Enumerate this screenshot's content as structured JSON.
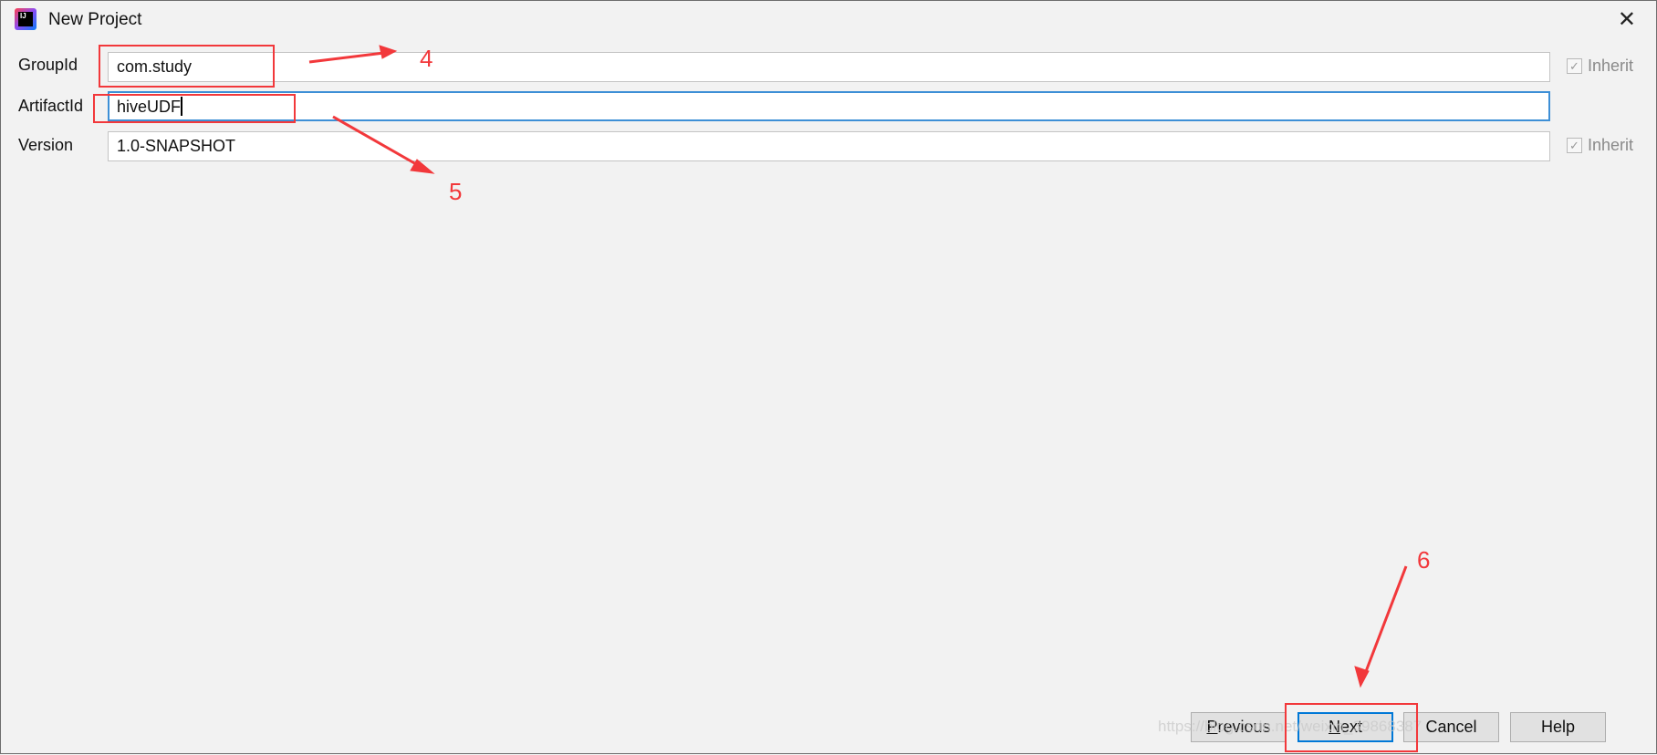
{
  "window": {
    "title": "New Project",
    "app_icon": "intellij-idea-icon",
    "close_icon": "close-x-icon"
  },
  "form": {
    "group_id": {
      "label": "GroupId",
      "value": "com.study",
      "inherit_label": "Inherit",
      "inherit_checked": true
    },
    "artifact_id": {
      "label": "ArtifactId",
      "value": "hiveUDF"
    },
    "version": {
      "label": "Version",
      "value": "1.0-SNAPSHOT",
      "inherit_label": "Inherit",
      "inherit_checked": true
    }
  },
  "buttons": {
    "previous": {
      "mnemonic": "P",
      "rest": "revious"
    },
    "next": {
      "mnemonic": "N",
      "rest": "ext"
    },
    "cancel": "Cancel",
    "help": "Help"
  },
  "annotations": {
    "step4": "4",
    "step5": "5",
    "step6": "6",
    "color": "#f2383b"
  },
  "watermark": "https://blog.csdn.net/weixin_39868387"
}
